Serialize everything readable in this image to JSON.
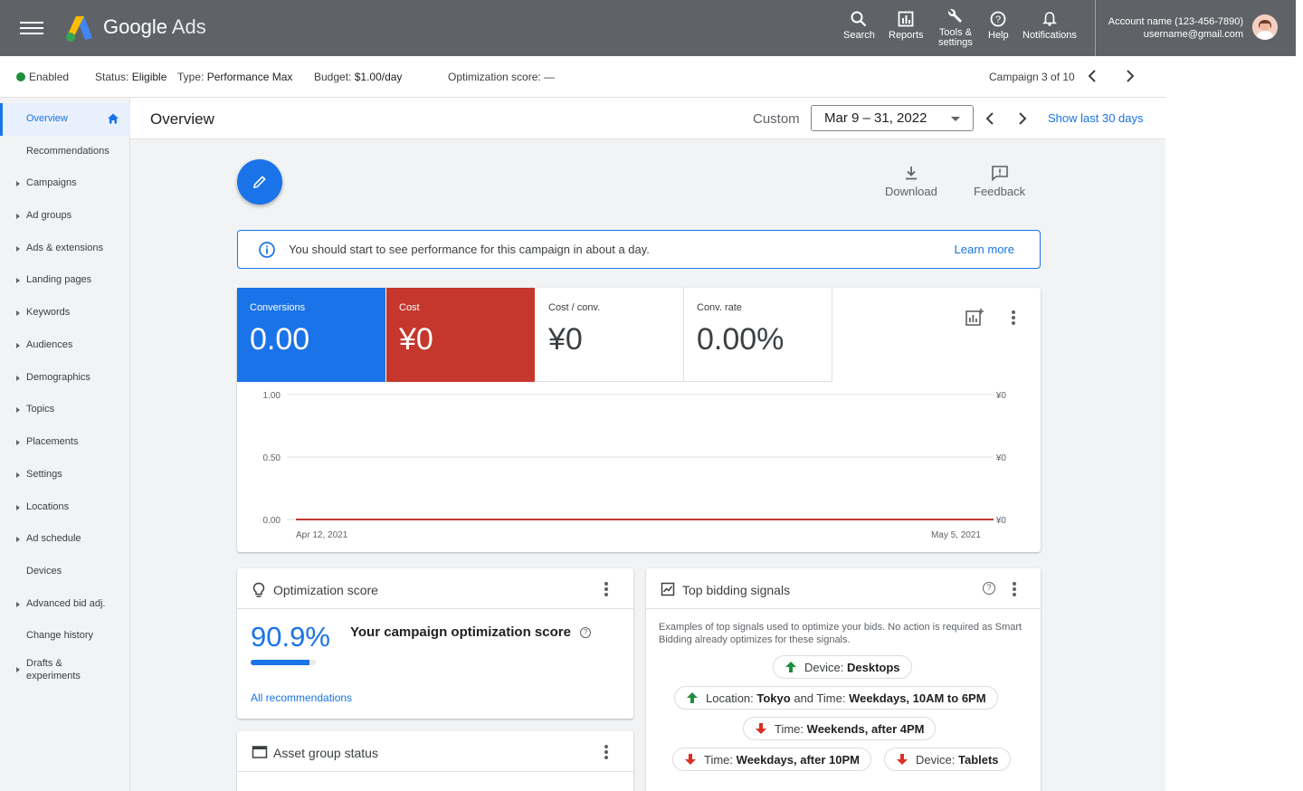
{
  "topbar": {
    "brand_google": "Google",
    "brand_ads": "Ads",
    "tools": [
      {
        "label": "Search",
        "icon": "search-icon"
      },
      {
        "label": "Reports",
        "icon": "reports-icon"
      },
      {
        "label": "Tools &",
        "label2": "settings",
        "icon": "wrench-icon"
      },
      {
        "label": "Help",
        "icon": "help-icon"
      },
      {
        "label": "Notifications",
        "icon": "bell-icon"
      }
    ],
    "account_name": "Account name (123-456-7890)",
    "account_email": "username@gmail.com"
  },
  "status": {
    "enabled": "Enabled",
    "status_label": "Status:",
    "status_value": "Eligible",
    "type_label": "Type:",
    "type_value": "Performance Max",
    "budget_label": "Budget:",
    "budget_value": "$1.00/day",
    "optimization": "Optimization score: —",
    "campaign_nav": "Campaign 3 of 10"
  },
  "sidebar": {
    "items": [
      {
        "label": "Overview",
        "arrow": false,
        "active": true
      },
      {
        "label": "Recommendations",
        "arrow": false
      },
      {
        "label": "Campaigns",
        "arrow": true
      },
      {
        "label": "Ad groups",
        "arrow": true
      },
      {
        "label": "Ads & extensions",
        "arrow": true
      },
      {
        "label": "Landing pages",
        "arrow": true
      },
      {
        "label": "Keywords",
        "arrow": true
      },
      {
        "label": "Audiences",
        "arrow": true
      },
      {
        "label": "Demographics",
        "arrow": true
      },
      {
        "label": "Topics",
        "arrow": true
      },
      {
        "label": "Placements",
        "arrow": true
      },
      {
        "label": "Settings",
        "arrow": true
      },
      {
        "label": "Locations",
        "arrow": true
      },
      {
        "label": "Ad schedule",
        "arrow": true
      },
      {
        "label": "Devices",
        "arrow": false
      },
      {
        "label": "Advanced bid adj.",
        "arrow": true
      },
      {
        "label": "Change history",
        "arrow": false
      },
      {
        "label": "Drafts &",
        "label2": "experiments",
        "arrow": true
      }
    ]
  },
  "header": {
    "title": "Overview",
    "custom": "Custom",
    "date_range": "Mar 9 – 31, 2022",
    "show_last": "Show last 30 days"
  },
  "actions": {
    "download": "Download",
    "feedback": "Feedback"
  },
  "notice": {
    "text": "You should start to see performance for this campaign in about a day.",
    "learn_more": "Learn more"
  },
  "metrics": [
    {
      "label": "Conversions",
      "value": "0.00"
    },
    {
      "label": "Cost",
      "value": "¥0"
    },
    {
      "label": "Cost / conv.",
      "value": "¥0"
    },
    {
      "label": "Conv. rate",
      "value": "0.00%"
    }
  ],
  "chart_data": {
    "type": "line",
    "x": [
      "Apr 12, 2021",
      "May 5, 2021"
    ],
    "series": [
      {
        "values": [
          0,
          0
        ],
        "color": "#c5372c"
      }
    ],
    "y_left_ticks": [
      "1.00",
      "0.50",
      "0.00"
    ],
    "y_right_ticks": [
      "¥0",
      "¥0",
      "¥0"
    ],
    "ylim": [
      0,
      1
    ],
    "grid": true
  },
  "optimization_card": {
    "title": "Optimization score",
    "score": "90.9%",
    "score_fraction": 0.909,
    "label": "Your campaign optimization score",
    "link": "All recommendations"
  },
  "asset_card": {
    "title": "Asset group status"
  },
  "bidding_card": {
    "title": "Top bidding signals",
    "description": "Examples of top signals used to optimize your bids. No action is required as Smart Bidding already optimizes for these signals.",
    "signals": [
      {
        "prefix": "Device:",
        "value": "Desktops",
        "direction": "up"
      },
      {
        "prefix": "Location:",
        "value": "Tokyo",
        "mid": "and Time:",
        "value2": "Weekdays, 10AM to 6PM",
        "direction": "up"
      },
      {
        "prefix": "Time:",
        "value": "Weekends, after 4PM",
        "direction": "down"
      },
      {
        "prefix": "Time:",
        "value": "Weekdays, after 10PM",
        "direction": "down"
      },
      {
        "prefix": "Device:",
        "value": "Tablets",
        "direction": "down"
      }
    ]
  },
  "colors": {
    "primary": "#1a73e8",
    "cost": "#c5372c",
    "topbar": "#5f6368",
    "up": "#1e8e3e",
    "down": "#d93025"
  }
}
